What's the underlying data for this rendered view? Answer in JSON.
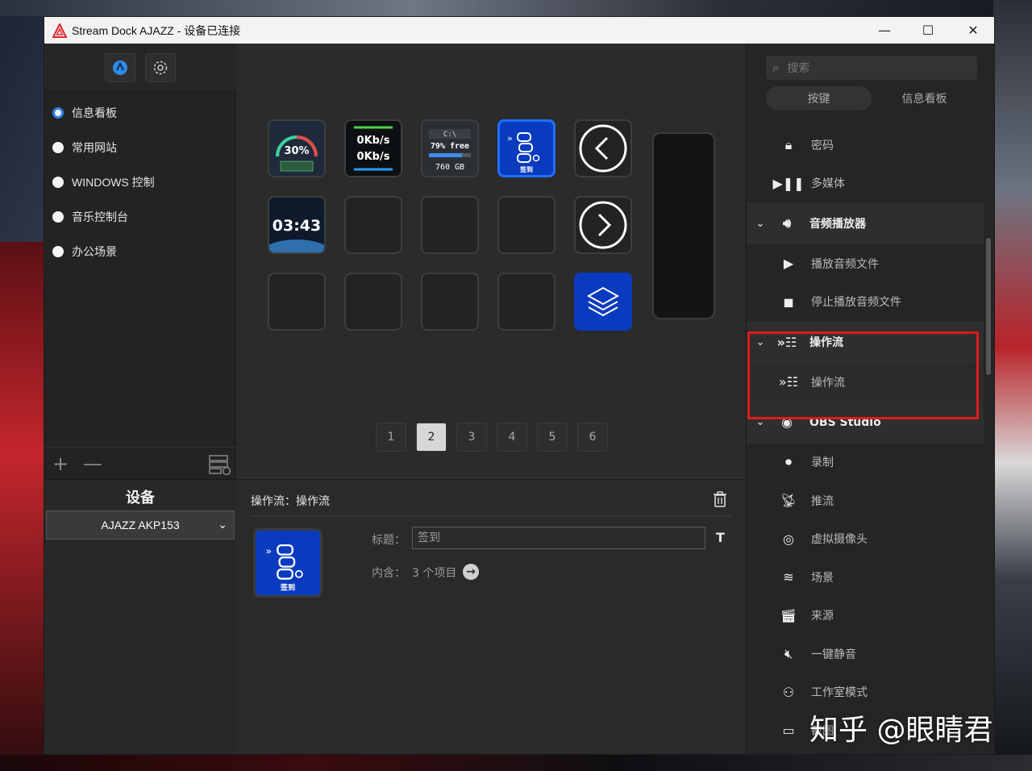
{
  "window": {
    "title": "Stream Dock AJAZZ - 设备已连接"
  },
  "left": {
    "profiles": [
      {
        "label": "信息看板",
        "selected": true
      },
      {
        "label": "常用网站",
        "selected": false
      },
      {
        "label": "WINDOWS 控制",
        "selected": false
      },
      {
        "label": "音乐控制台",
        "selected": false
      },
      {
        "label": "办公场景",
        "selected": false
      }
    ],
    "device_title": "设备",
    "device_value": "AJAZZ AKP153"
  },
  "keys": {
    "gauge_value": "30%",
    "net_up": "0Kb/s",
    "net_down": "0Kb/s",
    "disk_drive": "C:\\",
    "disk_free": "79% free",
    "disk_size": "760 GB",
    "flow_caption": "签到",
    "clock": "03:43"
  },
  "pager": [
    "1",
    "2",
    "3",
    "4",
    "5",
    "6"
  ],
  "pager_active": "2",
  "detail": {
    "header": "操作流：操作流",
    "title_label": "标题：",
    "title_value": "签到",
    "contains_label": "内含：",
    "contains_value": "3 个项目",
    "icon_caption": "签到"
  },
  "right": {
    "search_placeholder": "搜索",
    "tabs": [
      "按键",
      "信息看板"
    ],
    "items": {
      "password": "密码",
      "multimedia": "多媒体",
      "audio_player": "音频播放器",
      "play_audio": "播放音频文件",
      "stop_audio": "停止播放音频文件",
      "flow_cat": "操作流",
      "flow_item": "操作流",
      "obs": "OBS Studio",
      "record": "录制",
      "stream": "推流",
      "virtual_cam": "虚拟摄像头",
      "scene": "场景",
      "source": "来源",
      "mute": "一键静音",
      "studio_mode": "工作室模式",
      "screenshot": "截图"
    }
  },
  "watermark": "知乎 @眼睛君"
}
